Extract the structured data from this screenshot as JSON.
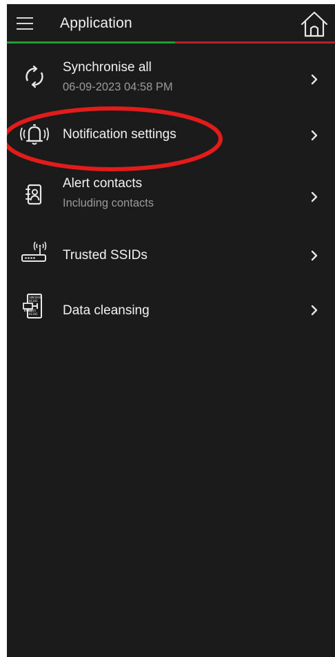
{
  "appbar": {
    "title": "Application",
    "accent_green": "#1f9d3a",
    "accent_red": "#b2252a",
    "menu_icon": "hamburger-menu-icon",
    "home_icon": "home-icon"
  },
  "menu": {
    "items": [
      {
        "label": "Synchronise all",
        "sublabel": "06-09-2023 04:58 PM",
        "icon": "sync-icon"
      },
      {
        "label": "Notification settings",
        "sublabel": "",
        "icon": "notification-bell-icon"
      },
      {
        "label": "Alert contacts",
        "sublabel": "Including contacts",
        "icon": "contacts-book-icon"
      },
      {
        "label": "Trusted SSIDs",
        "sublabel": "",
        "icon": "wifi-router-icon"
      },
      {
        "label": "Data cleansing",
        "sublabel": "",
        "icon": "data-cleansing-icon"
      }
    ]
  },
  "annotation": {
    "shape": "ellipse",
    "color": "#e21b1b",
    "target": "Notification settings"
  }
}
